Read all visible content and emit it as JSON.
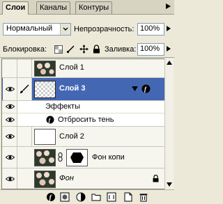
{
  "tabs": [
    "Слои",
    "Каналы",
    "Контуры"
  ],
  "blend": {
    "value": "Нормальный"
  },
  "opacity": {
    "label": "Непрозрачность:",
    "value": "100%"
  },
  "lock": {
    "label": "Блокировка:"
  },
  "fill": {
    "label": "Заливка:",
    "value": "100%"
  },
  "layers": [
    {
      "name": "Слой 1"
    },
    {
      "name": "Слой 3"
    },
    {
      "name": "Эффекты"
    },
    {
      "name": "Отбросить тень"
    },
    {
      "name": "Слой 2"
    },
    {
      "name": "Фон копи"
    },
    {
      "name": "Фон"
    }
  ],
  "colors": {
    "selection": "#4467B4",
    "panel": "#ECE9D8"
  }
}
